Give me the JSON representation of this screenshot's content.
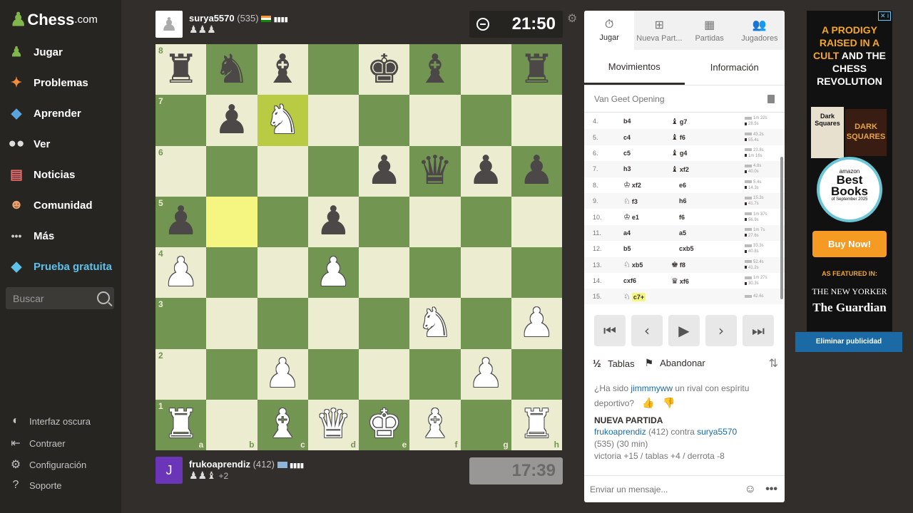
{
  "logo": {
    "brand": "Chess",
    "suffix": ".com"
  },
  "sidebar": {
    "items": [
      {
        "label": "Jugar",
        "icon": "play-board-icon"
      },
      {
        "label": "Problemas",
        "icon": "puzzle-icon"
      },
      {
        "label": "Aprender",
        "icon": "graduation-cap-icon"
      },
      {
        "label": "Ver",
        "icon": "binoculars-icon"
      },
      {
        "label": "Noticias",
        "icon": "newspaper-icon"
      },
      {
        "label": "Comunidad",
        "icon": "community-icon"
      },
      {
        "label": "Más",
        "icon": "more-dots-icon"
      },
      {
        "label": "Prueba gratuita",
        "icon": "diamond-icon"
      }
    ],
    "search_placeholder": "Buscar",
    "bottom": [
      {
        "label": "Interfaz oscura",
        "icon": "dark-mode-icon"
      },
      {
        "label": "Contraer",
        "icon": "collapse-icon"
      },
      {
        "label": "Configuración",
        "icon": "gear-icon"
      },
      {
        "label": "Soporte",
        "icon": "help-icon"
      }
    ]
  },
  "top_player": {
    "name": "surya5570",
    "rating": "(535)",
    "captured": "♟♟♟",
    "clock": "21:50"
  },
  "bottom_player": {
    "initial": "J",
    "name": "frukoaprendiz",
    "rating": "(412)",
    "captured": "♟♟♝",
    "advantage": "+2",
    "clock": "17:39"
  },
  "board": {
    "ranks": [
      "8",
      "7",
      "6",
      "5",
      "4",
      "3",
      "2",
      "1"
    ],
    "files": [
      "a",
      "b",
      "c",
      "d",
      "e",
      "f",
      "g",
      "h"
    ],
    "highlights": [
      {
        "sq": "b5",
        "tone": "light"
      },
      {
        "sq": "c7",
        "tone": "dark"
      }
    ],
    "pieces": [
      {
        "sq": "a8",
        "p": "♜",
        "c": "b"
      },
      {
        "sq": "b8",
        "p": "♞",
        "c": "b"
      },
      {
        "sq": "c8",
        "p": "♝",
        "c": "b"
      },
      {
        "sq": "e8",
        "p": "♚",
        "c": "b"
      },
      {
        "sq": "f8",
        "p": "♝",
        "c": "b"
      },
      {
        "sq": "h8",
        "p": "♜",
        "c": "b"
      },
      {
        "sq": "b7",
        "p": "♟",
        "c": "b"
      },
      {
        "sq": "c7",
        "p": "♞",
        "c": "w"
      },
      {
        "sq": "e6",
        "p": "♟",
        "c": "b"
      },
      {
        "sq": "f6",
        "p": "♛",
        "c": "b"
      },
      {
        "sq": "g6",
        "p": "♟",
        "c": "b"
      },
      {
        "sq": "h6",
        "p": "♟",
        "c": "b"
      },
      {
        "sq": "a5",
        "p": "♟",
        "c": "b"
      },
      {
        "sq": "d5",
        "p": "♟",
        "c": "b"
      },
      {
        "sq": "a4",
        "p": "♟",
        "c": "w"
      },
      {
        "sq": "d4",
        "p": "♟",
        "c": "w"
      },
      {
        "sq": "f3",
        "p": "♞",
        "c": "w"
      },
      {
        "sq": "h3",
        "p": "♟",
        "c": "w"
      },
      {
        "sq": "c2",
        "p": "♟",
        "c": "w"
      },
      {
        "sq": "g2",
        "p": "♟",
        "c": "w"
      },
      {
        "sq": "a1",
        "p": "♜",
        "c": "w"
      },
      {
        "sq": "c1",
        "p": "♝",
        "c": "w"
      },
      {
        "sq": "d1",
        "p": "♛",
        "c": "w"
      },
      {
        "sq": "e1",
        "p": "♚",
        "c": "w"
      },
      {
        "sq": "f1",
        "p": "♝",
        "c": "w"
      },
      {
        "sq": "h1",
        "p": "♜",
        "c": "w"
      }
    ]
  },
  "panel": {
    "top_tabs": [
      {
        "label": "Jugar",
        "icon": "stopwatch-icon",
        "glyph": "⏱"
      },
      {
        "label": "Nueva Part...",
        "icon": "new-game-icon",
        "glyph": "⊞"
      },
      {
        "label": "Partidas",
        "icon": "board-icon",
        "glyph": "▦"
      },
      {
        "label": "Jugadores",
        "icon": "players-icon",
        "glyph": "👥"
      }
    ],
    "sub_tabs": [
      "Movimientos",
      "Información"
    ],
    "opening": "Van Geet Opening",
    "moves": [
      {
        "n": "4.",
        "w": "b4",
        "wp": "",
        "b": "g7",
        "bp": "♝",
        "tw": "1m 22s",
        "tb": "28.5s"
      },
      {
        "n": "5.",
        "w": "c4",
        "wp": "",
        "b": "f6",
        "bp": "♝",
        "tw": "43.2s",
        "tb": "55.4s"
      },
      {
        "n": "6.",
        "w": "c5",
        "wp": "",
        "b": "g4",
        "bp": "♝",
        "tw": "23.8s",
        "tb": "1m 16s"
      },
      {
        "n": "7.",
        "w": "h3",
        "wp": "",
        "b": "xf2",
        "bp": "♝",
        "tw": "4.8s",
        "tb": "40.0s"
      },
      {
        "n": "8.",
        "w": "xf2",
        "wp": "♔",
        "b": "e6",
        "bp": "",
        "tw": "5.4s",
        "tb": "14.3s"
      },
      {
        "n": "9.",
        "w": "f3",
        "wp": "♘",
        "b": "h6",
        "bp": "",
        "tw": "15.3s",
        "tb": "41.7s"
      },
      {
        "n": "10.",
        "w": "e1",
        "wp": "♔",
        "b": "f6",
        "bp": "",
        "tw": "1m 37s",
        "tb": "56.9s"
      },
      {
        "n": "11.",
        "w": "a4",
        "wp": "",
        "b": "a5",
        "bp": "",
        "tw": "1m 7s",
        "tb": "27.6s"
      },
      {
        "n": "12.",
        "w": "b5",
        "wp": "",
        "b": "cxb5",
        "bp": "",
        "tw": "33.3s",
        "tb": "40.8s"
      },
      {
        "n": "13.",
        "w": "xb5",
        "wp": "♘",
        "b": "f8",
        "bp": "♚",
        "tw": "52.4s",
        "tb": "41.2s"
      },
      {
        "n": "14.",
        "w": "cxf6",
        "wp": "",
        "b": "xf6",
        "bp": "♛",
        "tw": "1m 27s",
        "tb": "30.3s"
      },
      {
        "n": "15.",
        "w": "c7+",
        "wp": "♘",
        "b": "",
        "bp": "",
        "tw": "42.6s",
        "tb": "",
        "current": true
      }
    ],
    "controls": [
      {
        "name": "first-move-button",
        "glyph": "⏮"
      },
      {
        "name": "previous-move-button",
        "glyph": "‹"
      },
      {
        "name": "play-button",
        "glyph": "▶"
      },
      {
        "name": "next-move-button",
        "glyph": "›"
      },
      {
        "name": "last-move-button",
        "glyph": "⏭"
      }
    ],
    "draw_label": "Tablas",
    "draw_glyph": "½",
    "resign_label": "Abandonar",
    "chat": {
      "prompt_pre": "¿Ha sido",
      "prompt_user": "jimmmyww",
      "prompt_post": "un rival con espíritu deportivo?",
      "new_game": "NUEVA PARTIDA",
      "white_player": "frukoaprendiz",
      "white_rating": "(412)",
      "vs": "contra",
      "black_player": "surya5570",
      "black_info": "(535) (30 min)",
      "stats": "victoria +15 / tablas +4 / derrota -8"
    },
    "message_placeholder": "Enviar un mensaje..."
  },
  "ad": {
    "headline_1": "A PRODIGY RAISED IN",
    "headline_2": "A CULT",
    "headline_3": "AND THE CHESS REVOLUTION",
    "book1": "Dark Squares",
    "book2": "DARK SQUARES",
    "badge_top": "amazon",
    "badge_main": "Best Books",
    "badge_sub": "of September 2025",
    "cta": "Buy Now!",
    "featured": "AS FEATURED IN:",
    "outlet1": "THE NEW YORKER",
    "outlet2": "The Guardian",
    "close": "✕ i",
    "remove": "Eliminar publicidad"
  },
  "colors": {
    "light_square": "#ebecd0",
    "dark_square": "#739552",
    "highlight": "#f5f682",
    "accent": "#81b64c",
    "link": "#1b6aa5"
  }
}
